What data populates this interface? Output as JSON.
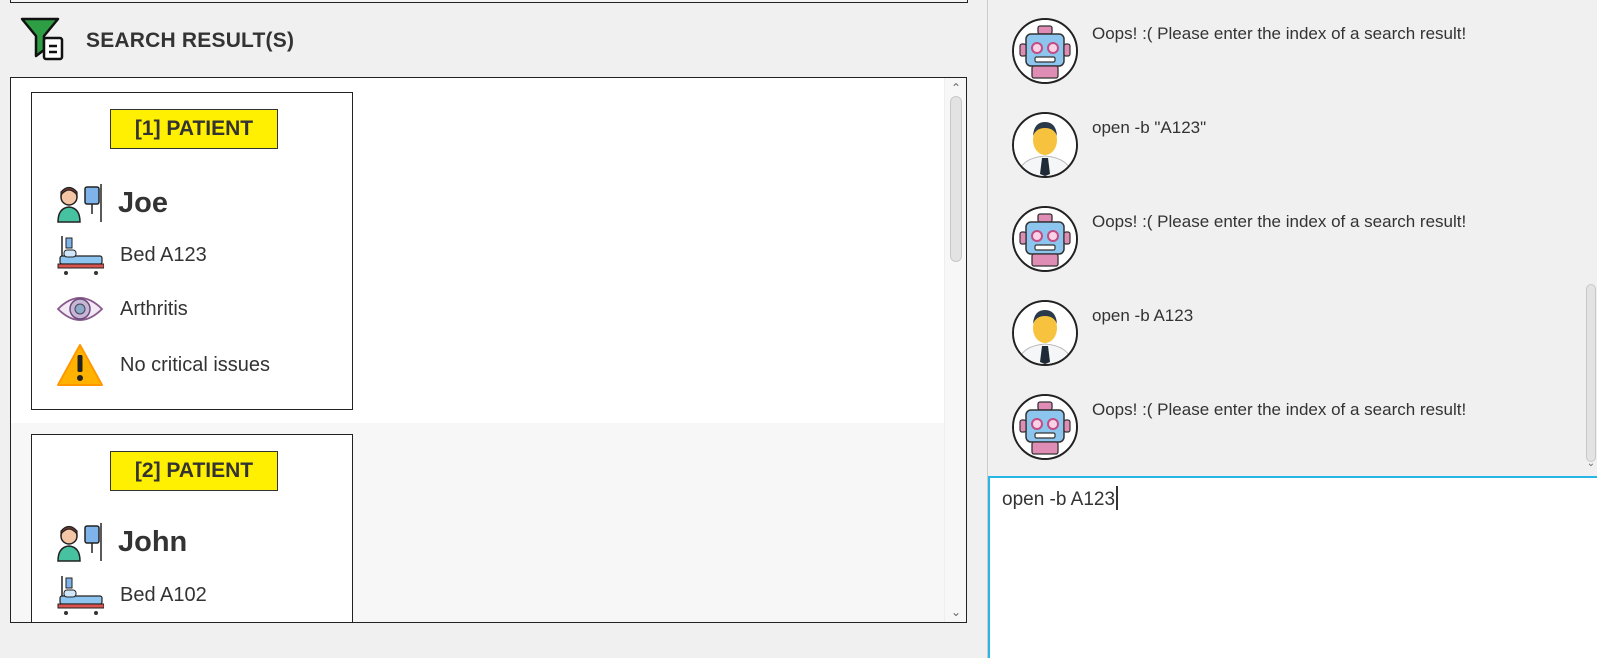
{
  "app": {
    "section_title": "SEARCH RESULT(S)"
  },
  "results": [
    {
      "badge": "[1] PATIENT",
      "name": "Joe",
      "bed": "Bed A123",
      "condition": "Arthritis",
      "critical": "No critical issues"
    },
    {
      "badge": "[2] PATIENT",
      "name": "John",
      "bed": "Bed A102"
    }
  ],
  "chat": {
    "messages": [
      {
        "sender": "bot",
        "text": "Oops! :( Please enter the index of a search result!"
      },
      {
        "sender": "user",
        "text": "open -b \"A123\""
      },
      {
        "sender": "bot",
        "text": "Oops! :( Please enter the index of a search result!"
      },
      {
        "sender": "user",
        "text": "open -b A123"
      },
      {
        "sender": "bot",
        "text": "Oops! :( Please enter the index of a search result!"
      }
    ]
  },
  "command_input": {
    "value": "open -b A123"
  },
  "colors": {
    "badge_bg": "#ffef00",
    "input_border": "#27b6e6",
    "filter_icon": "#2e9e44"
  }
}
